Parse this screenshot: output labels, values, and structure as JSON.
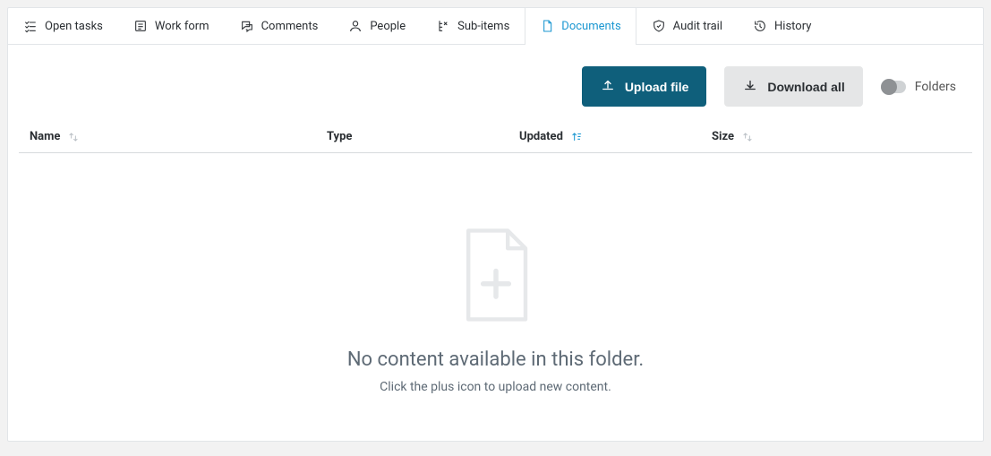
{
  "tabs": [
    {
      "id": "open-tasks",
      "label": "Open tasks",
      "icon": "checklist"
    },
    {
      "id": "work-form",
      "label": "Work form",
      "icon": "form"
    },
    {
      "id": "comments",
      "label": "Comments",
      "icon": "comments"
    },
    {
      "id": "people",
      "label": "People",
      "icon": "person"
    },
    {
      "id": "sub-items",
      "label": "Sub-items",
      "icon": "subitems"
    },
    {
      "id": "documents",
      "label": "Documents",
      "icon": "file",
      "active": true
    },
    {
      "id": "audit-trail",
      "label": "Audit trail",
      "icon": "shield"
    },
    {
      "id": "history",
      "label": "History",
      "icon": "history"
    }
  ],
  "toolbar": {
    "upload_label": "Upload file",
    "download_label": "Download all",
    "folders_label": "Folders"
  },
  "columns": {
    "name": "Name",
    "type": "Type",
    "updated": "Updated",
    "size": "Size"
  },
  "empty": {
    "title": "No content available in this folder.",
    "subtitle": "Click the plus icon to upload new content."
  }
}
